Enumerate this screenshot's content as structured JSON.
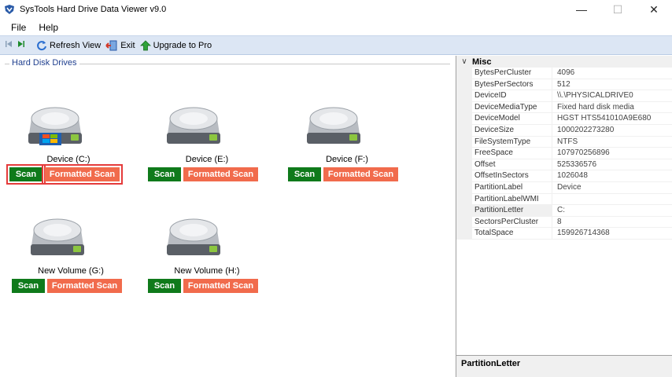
{
  "window": {
    "title": "SysTools Hard Drive Data Viewer v9.0",
    "minimize": "—",
    "maximize": "☐",
    "close": "✕"
  },
  "menu": {
    "items": [
      "File",
      "Help"
    ]
  },
  "toolbar": {
    "refresh_label": "Refresh View",
    "exit_label": "Exit",
    "upgrade_label": "Upgrade to Pro"
  },
  "left": {
    "group_title": "Hard Disk Drives",
    "drives": [
      {
        "label": "Device (C:)",
        "scan": "Scan",
        "formatted_scan": "Formatted Scan",
        "icon": "windows-hard-drive-icon"
      },
      {
        "label": "Device (E:)",
        "scan": "Scan",
        "formatted_scan": "Formatted Scan",
        "icon": "hard-drive-icon"
      },
      {
        "label": "Device (F:)",
        "scan": "Scan",
        "formatted_scan": "Formatted Scan",
        "icon": "hard-drive-icon"
      },
      {
        "label": "New Volume (G:)",
        "scan": "Scan",
        "formatted_scan": "Formatted Scan",
        "icon": "hard-drive-icon"
      },
      {
        "label": "New Volume (H:)",
        "scan": "Scan",
        "formatted_scan": "Formatted Scan",
        "icon": "hard-drive-icon"
      }
    ]
  },
  "properties": {
    "category": "Misc",
    "rows": [
      {
        "name": "BytesPerCluster",
        "value": "4096"
      },
      {
        "name": "BytesPerSectors",
        "value": "512"
      },
      {
        "name": "DeviceID",
        "value": "\\\\.\\PHYSICALDRIVE0"
      },
      {
        "name": "DeviceMediaType",
        "value": "Fixed hard disk media"
      },
      {
        "name": "DeviceModel",
        "value": "HGST HTS541010A9E680"
      },
      {
        "name": "DeviceSize",
        "value": "1000202273280"
      },
      {
        "name": "FileSystemType",
        "value": "NTFS"
      },
      {
        "name": "FreeSpace",
        "value": "107970256896"
      },
      {
        "name": "Offset",
        "value": "525336576"
      },
      {
        "name": "OffsetInSectors",
        "value": "1026048"
      },
      {
        "name": "PartitionLabel",
        "value": "Device"
      },
      {
        "name": "PartitionLabelWMI",
        "value": ""
      },
      {
        "name": "PartitionLetter",
        "value": "C:"
      },
      {
        "name": "SectorsPerCluster",
        "value": "8"
      },
      {
        "name": "TotalSpace",
        "value": "159926714368"
      }
    ],
    "description_title": "PartitionLetter"
  },
  "colors": {
    "scan_button": "#0f7a1b",
    "formatted_scan_button": "#f16b4c",
    "highlight": "#e53b3b",
    "toolbar_bg": "#dce6f4"
  }
}
